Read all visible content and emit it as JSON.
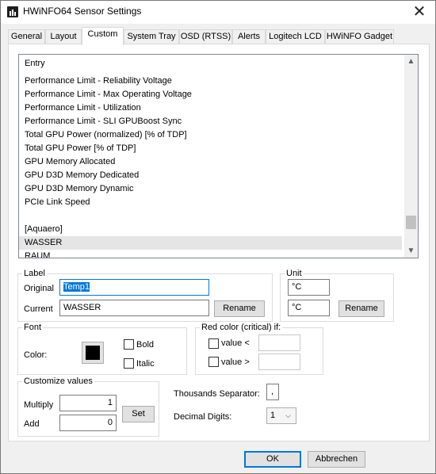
{
  "window": {
    "title": "HWiNFO64 Sensor Settings"
  },
  "tabs": [
    {
      "label": "General"
    },
    {
      "label": "Layout"
    },
    {
      "label": "Custom"
    },
    {
      "label": "System Tray"
    },
    {
      "label": "OSD (RTSS)"
    },
    {
      "label": "Alerts"
    },
    {
      "label": "Logitech LCD"
    },
    {
      "label": "HWiNFO Gadget"
    }
  ],
  "list": {
    "header": "Entry",
    "items": [
      "Performance Limit - Reliability Voltage",
      "Performance Limit - Max Operating Voltage",
      "Performance Limit - Utilization",
      "Performance Limit - SLI GPUBoost Sync",
      "Total GPU Power (normalized) [% of TDP]",
      "Total GPU Power [% of TDP]",
      "GPU Memory Allocated",
      "GPU D3D Memory Dedicated",
      "GPU D3D Memory Dynamic",
      "PCIe Link Speed",
      "",
      "[Aquaero]",
      "WASSER",
      "RAUM"
    ],
    "selected_item": "WASSER"
  },
  "label_group": {
    "title": "Label",
    "original_label": "Original",
    "original_value": "Temp1",
    "current_label": "Current",
    "current_value": "WASSER",
    "rename_button": "Rename"
  },
  "unit_group": {
    "title": "Unit",
    "original_value": "°C",
    "current_value": "°C",
    "rename_button": "Rename"
  },
  "font_group": {
    "title": "Font",
    "color_label": "Color:",
    "color_value": "#000000",
    "bold_label": "Bold",
    "bold_checked": false,
    "italic_label": "Italic",
    "italic_checked": false
  },
  "red_color_group": {
    "title": "Red color (critical) if:",
    "lt_label": "value <",
    "lt_checked": false,
    "lt_value": "",
    "gt_label": "value >",
    "gt_checked": false,
    "gt_value": ""
  },
  "customize_group": {
    "title": "Customize values",
    "multiply_label": "Multiply",
    "multiply_value": "1",
    "add_label": "Add",
    "add_value": "0",
    "set_button": "Set"
  },
  "thousands": {
    "label": "Thousands Separator:",
    "value": ","
  },
  "decimal": {
    "label": "Decimal Digits:",
    "value": "1"
  },
  "footer": {
    "ok_button": "OK",
    "cancel_button": "Abbrechen"
  },
  "icons": {
    "app": "hwinfo-app-icon",
    "close": "close-icon",
    "scroll_up": "chevron-up-icon",
    "scroll_down": "chevron-down-icon",
    "combo": "chevron-down-icon"
  }
}
